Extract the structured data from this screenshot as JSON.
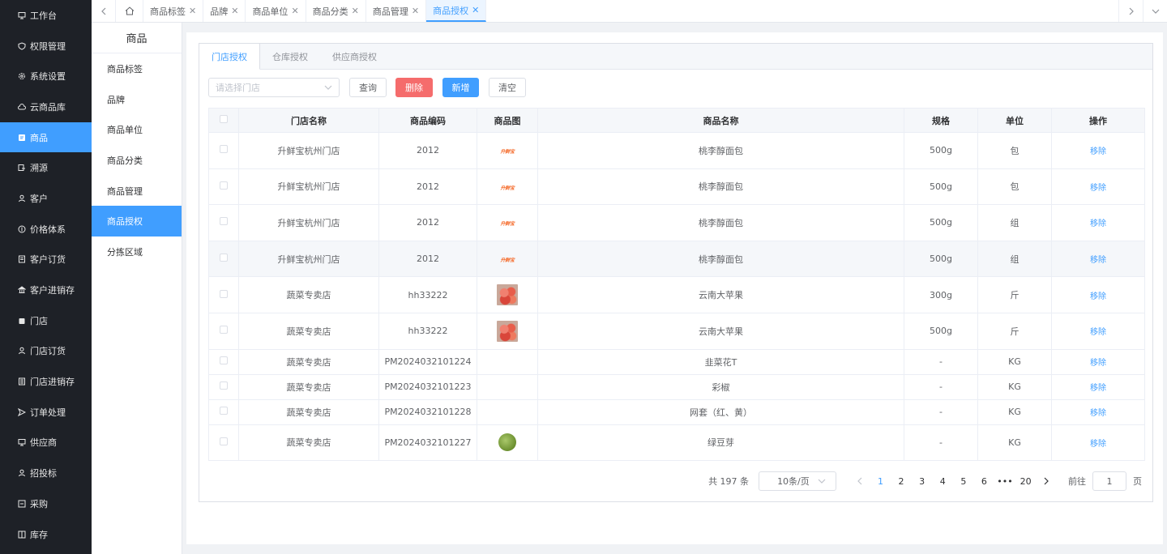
{
  "sidebar": {
    "items": [
      {
        "label": "工作台",
        "icon": "monitor-icon"
      },
      {
        "label": "权限管理",
        "icon": "shield-icon"
      },
      {
        "label": "系统设置",
        "icon": "gear-icon"
      },
      {
        "label": "云商品库",
        "icon": "cloud-icon"
      },
      {
        "label": "商品",
        "icon": "goods-icon",
        "active": true
      },
      {
        "label": "溯源",
        "icon": "trace-icon"
      },
      {
        "label": "客户",
        "icon": "user-icon"
      },
      {
        "label": "价格体系",
        "icon": "price-icon"
      },
      {
        "label": "客户订货",
        "icon": "order-icon"
      },
      {
        "label": "客户进销存",
        "icon": "bank-icon"
      },
      {
        "label": "门店",
        "icon": "store-icon"
      },
      {
        "label": "门店订货",
        "icon": "user-icon"
      },
      {
        "label": "门店进销存",
        "icon": "doc-icon"
      },
      {
        "label": "订单处理",
        "icon": "send-icon"
      },
      {
        "label": "供应商",
        "icon": "monitor-icon"
      },
      {
        "label": "招投标",
        "icon": "user-icon"
      },
      {
        "label": "采购",
        "icon": "purchase-icon"
      },
      {
        "label": "库存",
        "icon": "stock-icon"
      }
    ]
  },
  "topbar": {
    "tabs": [
      {
        "label": "商品标签"
      },
      {
        "label": "品牌"
      },
      {
        "label": "商品单位"
      },
      {
        "label": "商品分类"
      },
      {
        "label": "商品管理"
      },
      {
        "label": "商品授权",
        "active": true
      }
    ]
  },
  "submenu": {
    "title": "商品",
    "items": [
      "商品标签",
      "品牌",
      "商品单位",
      "商品分类",
      "商品管理",
      "商品授权",
      "分拣区域"
    ],
    "active_index": 5
  },
  "panel": {
    "tabs": [
      "门店授权",
      "仓库授权",
      "供应商授权"
    ],
    "active_tab": 0
  },
  "toolbar": {
    "store_placeholder": "请选择门店",
    "query_label": "查询",
    "delete_label": "删除",
    "add_label": "新增",
    "clear_label": "清空"
  },
  "table": {
    "headers": [
      "门店名称",
      "商品编码",
      "商品图",
      "商品名称",
      "规格",
      "单位",
      "操作"
    ],
    "rows": [
      {
        "store": "升鲜宝杭州门店",
        "code": "2012",
        "img": "logo",
        "logo_text": "升鲜宝",
        "name": "桃李醇面包",
        "spec": "500g",
        "unit": "包",
        "action": "移除"
      },
      {
        "store": "升鲜宝杭州门店",
        "code": "2012",
        "img": "logo",
        "logo_text": "升鲜宝",
        "name": "桃李醇面包",
        "spec": "500g",
        "unit": "包",
        "action": "移除"
      },
      {
        "store": "升鲜宝杭州门店",
        "code": "2012",
        "img": "logo",
        "logo_text": "升鲜宝",
        "name": "桃李醇面包",
        "spec": "500g",
        "unit": "组",
        "action": "移除"
      },
      {
        "store": "升鲜宝杭州门店",
        "code": "2012",
        "img": "logo",
        "logo_text": "升鲜宝",
        "name": "桃李醇面包",
        "spec": "500g",
        "unit": "组",
        "action": "移除"
      },
      {
        "store": "蔬菜专卖店",
        "code": "hh33222",
        "img": "apple",
        "name": "云南大苹果",
        "spec": "300g",
        "unit": "斤",
        "action": "移除"
      },
      {
        "store": "蔬菜专卖店",
        "code": "hh33222",
        "img": "apple",
        "name": "云南大苹果",
        "spec": "500g",
        "unit": "斤",
        "action": "移除"
      },
      {
        "store": "蔬菜专卖店",
        "code": "PM2024032101224",
        "img": "",
        "name": "韭菜花T",
        "spec": "-",
        "unit": "KG",
        "action": "移除"
      },
      {
        "store": "蔬菜专卖店",
        "code": "PM2024032101223",
        "img": "",
        "name": "彩椒",
        "spec": "-",
        "unit": "KG",
        "action": "移除"
      },
      {
        "store": "蔬菜专卖店",
        "code": "PM2024032101228",
        "img": "",
        "name": "网套（红、黄）",
        "spec": "-",
        "unit": "KG",
        "action": "移除"
      },
      {
        "store": "蔬菜专卖店",
        "code": "PM2024032101227",
        "img": "sprout",
        "name": "绿豆芽",
        "spec": "-",
        "unit": "KG",
        "action": "移除"
      }
    ]
  },
  "pagination": {
    "total_text": "共 197 条",
    "page_size": "10条/页",
    "pages": [
      "1",
      "2",
      "3",
      "4",
      "5",
      "6",
      "•••",
      "20"
    ],
    "current": "1",
    "goto_label": "前往",
    "goto_value": "1",
    "page_suffix": "页"
  }
}
